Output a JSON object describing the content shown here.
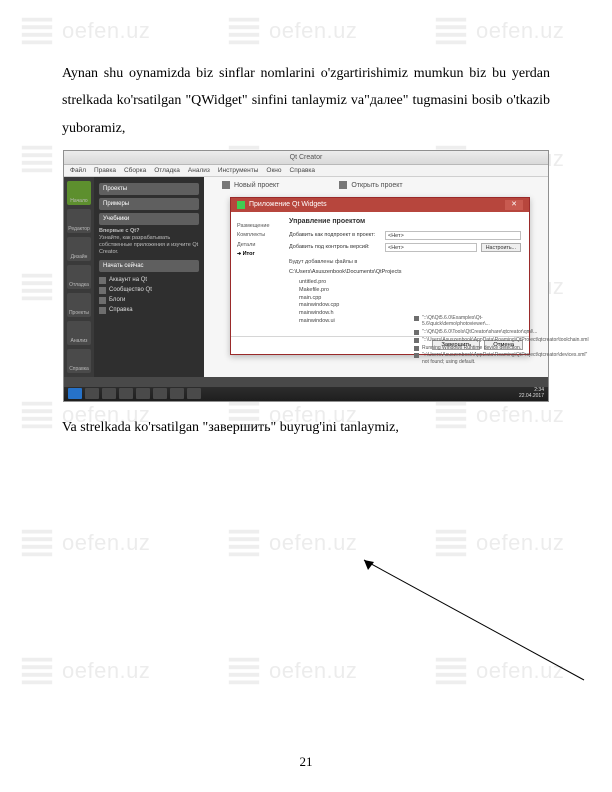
{
  "watermark_text": "oefen.uz",
  "para1": "Aynan shu oynamizda biz sinflar nomlarini o'zgartirishimiz mumkun  biz bu yerdan strelkada ko'rsatilgan \"QWidget\" sinfini tanlaymiz va\"далее\" tugmasini bosib o'tkazib yuboramiz,",
  "para2": "Va strelkada ko'rsatilgan \"завершить\" buyrug'ini tanlaymiz,",
  "page_number": "21",
  "qt": {
    "window_title": "Qt Creator",
    "menu": [
      "Файл",
      "Правка",
      "Сборка",
      "Отладка",
      "Анализ",
      "Инструменты",
      "Окно",
      "Справка"
    ],
    "leftbar": [
      "Начало",
      "Редактор",
      "Дизайн",
      "Отладка",
      "Проекты",
      "Анализ",
      "Справка"
    ],
    "sidepanel": {
      "projects_btn": "Проекты",
      "examples_btn": "Примеры",
      "uchebniki_btn": "Учебники",
      "blurb_title": "Впервые с Qt?",
      "blurb_text": "Узнайте, как разрабатывать собственные приложения и изучите Qt Creator.",
      "start_btn": "Начать сейчас",
      "links": [
        "Аккаунт на Qt",
        "Сообщество Qt",
        "Блоги",
        "Справка"
      ]
    },
    "toptabs": [
      "Новый проект",
      "Открыть проект"
    ],
    "dialog": {
      "title": "Приложение Qt Widgets",
      "heading": "Управление проектом",
      "steps": [
        "Размещение",
        "Комплекты",
        "Детали",
        "Итог"
      ],
      "row1_label": "Добавить как подпроект в проект:",
      "row1_value": "<Нет>",
      "row2_label": "Добавить под контроль версий:",
      "row2_value": "<Нет>",
      "row2_btn": "Настроить...",
      "files_hdr": "Будут добавлены файлы в",
      "files_path": "C:\\Users\\Asuszenbook\\Documents\\QtProjects",
      "files": [
        "untitled.pro",
        "Makefile.pro",
        "main.cpp",
        "mainwindow.cpp",
        "mainwindow.h",
        "mainwindow.ui"
      ],
      "btn_finish": "Завершить",
      "btn_cancel": "Отмена"
    },
    "notes": [
      "\"::\\Qt\\Qt5.6.0\\Examples\\Qt-5.6\\quick\\demo\\photoviewer\\...",
      "\"::\\Qt\\Qt5.6.0\\Tools\\QtCreator\\share\\qtcreator\\qml\\...",
      "\"::\\Users\\Asuszenbook\\AppData\\Roaming\\QtProject\\qtcreator\\toolchain.xml",
      "Running Windows Runtime device detection.",
      "\"::\\Users\\Asuszenbook\\AppData\\Roaming\\QtProject\\qtcreator\\devices.xml\" not found; using default."
    ],
    "clock": {
      "time": "2:34",
      "date": "22.04.2017"
    }
  }
}
